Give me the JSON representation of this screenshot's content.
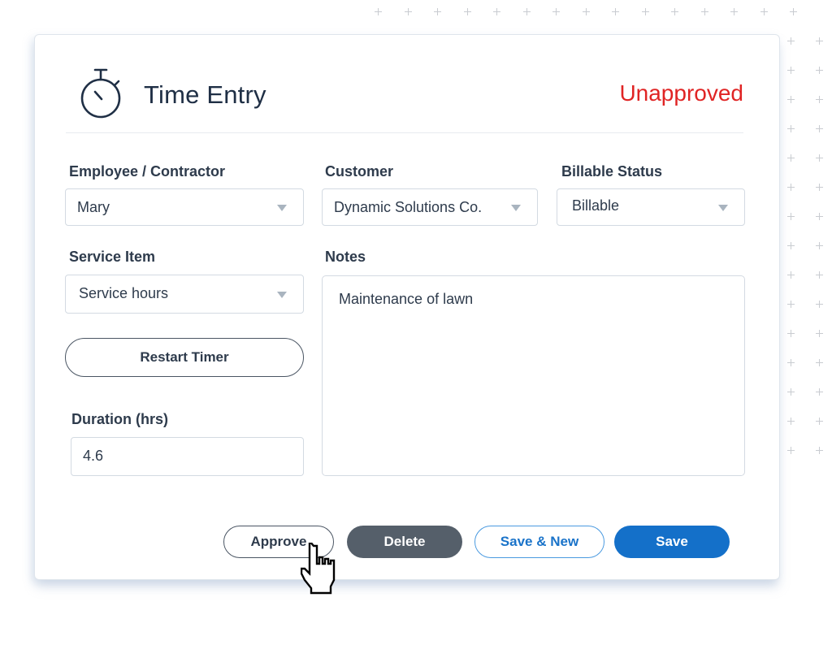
{
  "header": {
    "title": "Time Entry",
    "icon": "stopwatch-icon",
    "status": "Unapproved",
    "status_color": "#e02424"
  },
  "form": {
    "employee": {
      "label": "Employee / Contractor",
      "value": "Mary"
    },
    "customer": {
      "label": "Customer",
      "value": "Dynamic Solutions Co."
    },
    "billable": {
      "label": "Billable Status",
      "value": "Billable"
    },
    "service": {
      "label": "Service Item",
      "value": "Service hours"
    },
    "notes": {
      "label": "Notes",
      "value": "Maintenance of lawn"
    },
    "restart_timer_label": "Restart Timer",
    "duration": {
      "label": "Duration (hrs)",
      "value": "4.6"
    }
  },
  "actions": {
    "approve_label": "Approve",
    "delete_label": "Delete",
    "save_new_label": "Save & New",
    "save_label": "Save",
    "primary_color": "#1470c9"
  },
  "cursor": {
    "icon": "hand-pointer-icon"
  }
}
